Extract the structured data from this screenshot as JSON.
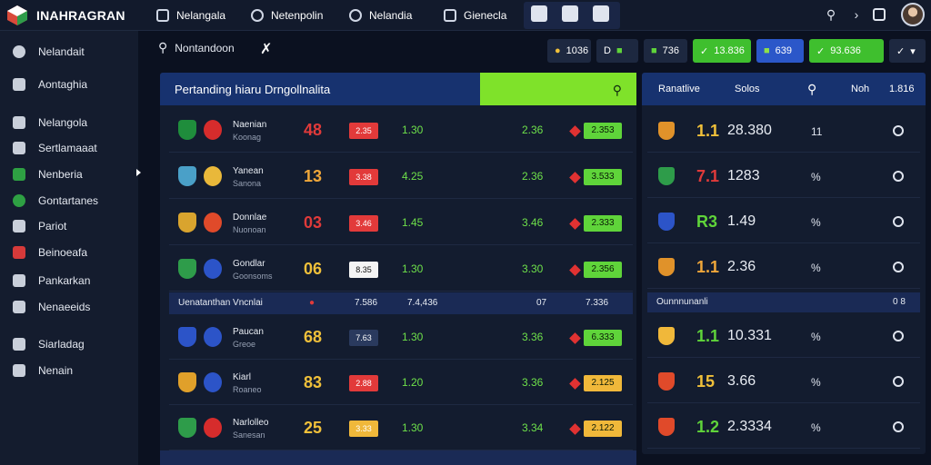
{
  "app": {
    "title": "INAHRAGRAN"
  },
  "nav": {
    "tabs": [
      {
        "label": "Nelangala",
        "icon": "shield-icon"
      },
      {
        "label": "Netenpolin",
        "icon": "ball-icon"
      },
      {
        "label": "Nelandia",
        "icon": "ball-icon"
      },
      {
        "label": "Gienecla",
        "icon": "calendar-icon"
      }
    ],
    "icons": [
      "search-icon",
      "chevron-right-icon",
      "notification-icon",
      "avatar"
    ]
  },
  "sidebar": {
    "items": [
      {
        "label": "Nelandait",
        "icon": "circle-icon"
      },
      {
        "label": "Aontaghia",
        "icon": "home-icon"
      },
      {
        "label": "Nelangola",
        "icon": "tool-icon"
      },
      {
        "label": "Sertlamaaat",
        "icon": "person-icon"
      },
      {
        "label": "Nenberia",
        "icon": "green-icon"
      },
      {
        "label": "Gontartanes",
        "icon": "green-circle-icon"
      },
      {
        "label": "Pariot",
        "icon": "chart-icon"
      },
      {
        "label": "Beinoeafa",
        "icon": "red-icon"
      },
      {
        "label": "Pankarkan",
        "icon": "tag-icon"
      },
      {
        "label": "Nenaeeids",
        "icon": "doc-icon"
      },
      {
        "label": "Siarladag",
        "icon": "tool-icon"
      },
      {
        "label": "Nenain",
        "icon": "gear-icon"
      }
    ]
  },
  "subhead": {
    "label": "Nontandoon"
  },
  "chips": [
    {
      "icon": "coin-icon",
      "text": "1036"
    },
    {
      "icon": "d-icon",
      "text": "D"
    },
    {
      "icon": "money-icon",
      "text": "736"
    },
    {
      "icon": "check-icon",
      "text": "13.836"
    },
    {
      "icon": "flag-icon",
      "text": "639"
    },
    {
      "icon": "check-icon",
      "text": "93.636"
    },
    {
      "icon": "menu-icon",
      "text": "▾"
    }
  ],
  "main": {
    "title": "Pertanding hiaru Drngollnalita",
    "matches": [
      {
        "name": "Naenian",
        "sub": "Koonag",
        "score": "48",
        "score_color": "#e03a3a",
        "oddbox": "2.35",
        "oddbox_color": "#e23a3a",
        "odd1": "1.30",
        "odd2": "2.36",
        "odd3": "2.353",
        "odd3_color": "#5fd43a",
        "crestA": "#1f8d3c",
        "crestB": "#d62c2c"
      },
      {
        "name": "Yanean",
        "sub": "Sanona",
        "score": "13",
        "score_color": "#f0a73a",
        "oddbox": "3.38",
        "oddbox_color": "#e23a3a",
        "odd1": "4.25",
        "odd2": "2.36",
        "odd3": "3.533",
        "odd3_color": "#5fd43a",
        "crestA": "#4aa0c8",
        "crestB": "#e9b83a"
      },
      {
        "name": "Donnlae",
        "sub": "Nuonoan",
        "score": "03",
        "score_color": "#e03a3a",
        "oddbox": "3.46",
        "oddbox_color": "#e23a3a",
        "odd1": "1.45",
        "odd2": "3.46",
        "odd3": "2.333",
        "odd3_color": "#5fd43a",
        "crestA": "#d9a42e",
        "crestB": "#e04a2a"
      },
      {
        "name": "Gondlar",
        "sub": "Goonsoms",
        "score": "06",
        "score_color": "#f0c03a",
        "oddbox": "8.35",
        "oddbox_color": "#f4f4f4",
        "odd1": "1.30",
        "odd2": "3.30",
        "odd3": "2.356",
        "odd3_color": "#5fd43a",
        "crestA": "#2e9c4a",
        "crestB": "#2c54c8"
      },
      {
        "name": "Paucan",
        "sub": "Greoe",
        "score": "68",
        "score_color": "#f0c03a",
        "oddbox": "7.63",
        "oddbox_color": "#2a3a5e",
        "odd1": "1.30",
        "odd2": "3.36",
        "odd3": "6.333",
        "odd3_color": "#5fd43a",
        "crestA": "#2c54c8",
        "crestB": "#2c54c8"
      },
      {
        "name": "Kiarl",
        "sub": "Roaneo",
        "score": "83",
        "score_color": "#f0c03a",
        "oddbox": "2.88",
        "oddbox_color": "#e23a3a",
        "odd1": "1.20",
        "odd2": "3.36",
        "odd3": "2.125",
        "odd3_color": "#f0b83a",
        "crestA": "#e0a02a",
        "crestB": "#2c54c8"
      },
      {
        "name": "Narlolleo",
        "sub": "Sanesan",
        "score": "25",
        "score_color": "#f0c03a",
        "oddbox": "3.33",
        "oddbox_color": "#f0b83a",
        "odd1": "1.30",
        "odd2": "3.34",
        "odd3": "2.122",
        "odd3_color": "#f0b83a",
        "crestA": "#2e9c4a",
        "crestB": "#d62c2c"
      }
    ],
    "separator": {
      "label": "Uenatanthan Vncnlai",
      "v1": "7.586",
      "v2": "7.4,436",
      "v3": "07",
      "v4": "7.336"
    }
  },
  "right": {
    "head": {
      "col1": "Ranatlive",
      "col2": "Solos",
      "col3": "Noh",
      "col4": "1.816"
    },
    "rows": [
      {
        "score": "1.1",
        "score_color": "#f0c03a",
        "val": "28.380",
        "mid": "11",
        "crest": "#e0922a"
      },
      {
        "score": "7.1",
        "score_color": "#e03a3a",
        "val": "1283",
        "mid": "%",
        "crest": "#2e9c4a"
      },
      {
        "score": "R3",
        "score_color": "#5fd43a",
        "val": "1.49",
        "mid": "%",
        "crest": "#2c54c8"
      },
      {
        "score": "1.1",
        "score_color": "#f0a73a",
        "val": "2.36",
        "mid": "%",
        "crest": "#e0922a"
      },
      {
        "score": "1.1",
        "score_color": "#5fd43a",
        "val": "10.331",
        "mid": "%",
        "crest": "#f0b83a"
      },
      {
        "score": "15",
        "score_color": "#f0c03a",
        "val": "3.66",
        "mid": "%",
        "crest": "#e04a2a"
      },
      {
        "score": "1.2",
        "score_color": "#5fd43a",
        "val": "2.3334",
        "mid": "%",
        "crest": "#e04a2a"
      }
    ],
    "separator": {
      "label": "Ounnnunanli",
      "v1": "0 8"
    }
  }
}
